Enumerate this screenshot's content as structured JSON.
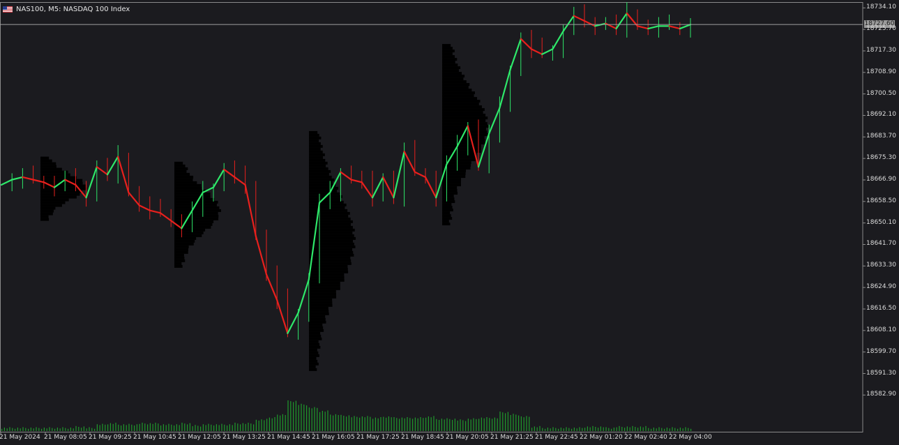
{
  "header": {
    "symbol_title": "NAS100, M5:  NASDAQ 100 Index"
  },
  "current_price_label": "18727.60",
  "colors": {
    "bg": "#1b1b1f",
    "bull": "#2ee86a",
    "bear": "#e8201d",
    "volume": "#1f9a2c",
    "profile": "#000000",
    "axis_text": "#dcdcdc"
  },
  "chart_data": {
    "type": "line",
    "title": "NAS100, M5:  NASDAQ 100 Index",
    "ylim": [
      18577,
      18735
    ],
    "y_ticks": [
      "18734.10",
      "18725.70",
      "18717.30",
      "18708.90",
      "18700.50",
      "18692.10",
      "18683.70",
      "18675.30",
      "18666.90",
      "18658.50",
      "18650.10",
      "18641.70",
      "18633.30",
      "18624.90",
      "18616.50",
      "18608.10",
      "18599.70",
      "18591.30",
      "18582.90"
    ],
    "x_ticks": [
      "21 May 2024",
      "21 May 08:05",
      "21 May 09:25",
      "21 May 10:45",
      "21 May 12:05",
      "21 May 13:25",
      "21 May 14:45",
      "21 May 16:05",
      "21 May 17:25",
      "21 May 18:45",
      "21 May 20:05",
      "21 May 21:25",
      "21 May 22:45",
      "22 May 01:20",
      "22 May 02:40",
      "22 May 04:00"
    ],
    "current_price": 18727.6,
    "series": [
      {
        "x_index": [
          0,
          4,
          8,
          12,
          16,
          20,
          24,
          28,
          32,
          36,
          40,
          44,
          48,
          52,
          56,
          60,
          64,
          68,
          72,
          76,
          80,
          84,
          88,
          92,
          96,
          100,
          104,
          108,
          112,
          116,
          120,
          124,
          128,
          132,
          136,
          140,
          144,
          148,
          152,
          156,
          160,
          164,
          168,
          172,
          176,
          180,
          184,
          188,
          192,
          196,
          200,
          204,
          208,
          212,
          216,
          220,
          224,
          228,
          232,
          236,
          240,
          244,
          248,
          252,
          256,
          260
        ],
        "values": [
          18665,
          18667,
          18668,
          18667,
          18666,
          18664,
          18667,
          18665,
          18660,
          18672,
          18669,
          18676,
          18662,
          18657,
          18655,
          18654,
          18651,
          18648,
          18655,
          18662,
          18664,
          18671,
          18668,
          18665,
          18645,
          18630,
          18620,
          18607,
          18615,
          18628,
          18658,
          18662,
          18670,
          18667,
          18666,
          18660,
          18668,
          18660,
          18678,
          18670,
          18668,
          18660,
          18673,
          18680,
          18688,
          18672,
          18685,
          18695,
          18710,
          18722,
          18718,
          18716,
          18718,
          18725,
          18731,
          18729,
          18727,
          18728,
          18726,
          18732,
          18727,
          18726,
          18727,
          18727,
          18726,
          18727.6
        ]
      }
    ],
    "volume_profiles": [
      {
        "range": [
          18651,
          18676
        ],
        "max_volume": 1.0
      },
      {
        "range": [
          18633,
          18674
        ],
        "max_volume": 1.0
      },
      {
        "range": [
          18592,
          18686
        ],
        "max_volume": 1.0
      },
      {
        "range": [
          18649,
          18720
        ],
        "max_volume": 1.0
      }
    ],
    "volume": [
      2,
      2,
      2,
      2,
      2,
      2,
      2,
      3,
      2,
      5,
      6,
      5,
      5,
      6,
      6,
      5,
      5,
      6,
      4,
      5,
      5,
      5,
      6,
      6,
      9,
      11,
      14,
      26,
      23,
      20,
      17,
      14,
      13,
      12,
      12,
      11,
      12,
      11,
      11,
      11,
      12,
      10,
      10,
      9,
      10,
      11,
      11,
      16,
      14,
      12,
      3,
      2,
      2,
      2,
      2,
      3,
      3,
      2,
      3,
      3,
      3,
      2,
      2,
      2,
      2,
      2
    ],
    "grid": false,
    "legend": "none"
  }
}
